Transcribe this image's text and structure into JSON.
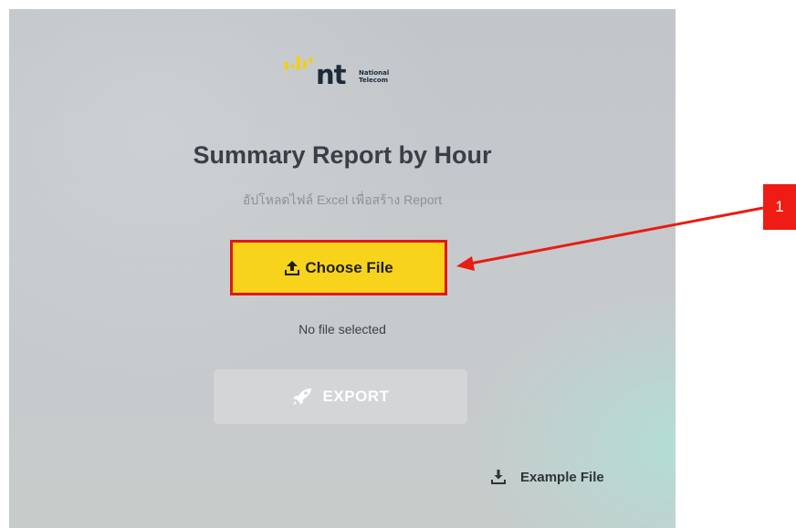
{
  "logo": {
    "brand": "nt",
    "brand_sub_line1": "National",
    "brand_sub_line2": "Telecom",
    "colors": {
      "mark": "#f4d000",
      "text": "#1c2a3a"
    }
  },
  "header": {
    "title": "Summary Report by Hour",
    "subtitle": "อัปโหลดไฟล์ Excel เพื่อสร้าง Report"
  },
  "upload": {
    "choose_label": "Choose File",
    "choose_icon": "upload-icon",
    "status": "No file selected"
  },
  "export": {
    "label": "EXPORT",
    "icon": "rocket-icon",
    "state": "disabled"
  },
  "example": {
    "label": "Example File",
    "icon": "download-icon"
  },
  "annotation": {
    "number": "1",
    "color": "#ee1c14"
  },
  "colors": {
    "accent_yellow": "#f7d31b",
    "highlight_red": "#e01818"
  }
}
